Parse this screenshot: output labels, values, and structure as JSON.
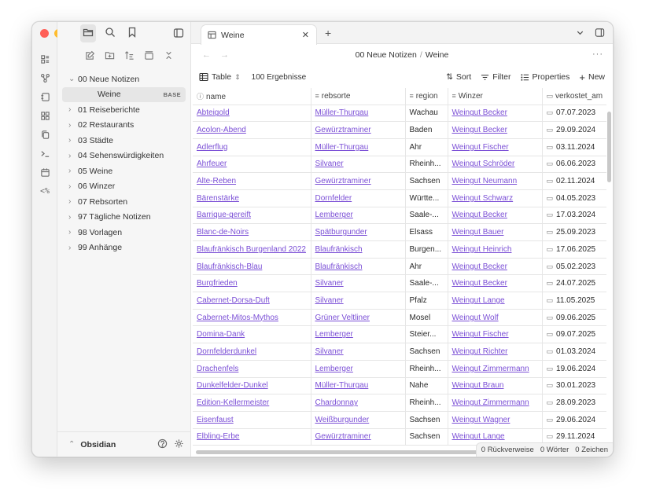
{
  "colors": {
    "close": "#ff5f57",
    "minimize": "#febc2e",
    "zoom": "#28c840",
    "link": "#7b4fd6"
  },
  "ribbon": {
    "icons": [
      "files-icon",
      "graph-icon",
      "canvas-icon",
      "dashboard-icon",
      "copy-icon",
      "terminal-icon",
      "calendar-icon",
      "code-percent-icon"
    ],
    "code_label": "<%"
  },
  "sidebar": {
    "tree": [
      {
        "label": "00 Neue Notizen",
        "expanded": true
      },
      {
        "label": "Weine",
        "badge": "BASE",
        "sub": true
      },
      {
        "label": "01 Reiseberichte"
      },
      {
        "label": "02 Restaurants"
      },
      {
        "label": "03 Städte"
      },
      {
        "label": "04 Sehenswürdigkeiten"
      },
      {
        "label": "05 Weine"
      },
      {
        "label": "06 Winzer"
      },
      {
        "label": "07 Rebsorten"
      },
      {
        "label": "97 Tägliche Notizen"
      },
      {
        "label": "98 Vorlagen"
      },
      {
        "label": "99 Anhänge"
      }
    ],
    "vault_name": "Obsidian"
  },
  "tab": {
    "title": "Weine"
  },
  "breadcrumb": {
    "folder": "00 Neue Notizen",
    "sep": "/",
    "file": "Weine"
  },
  "toolbar": {
    "view_label": "Table",
    "count": "100 Ergebnisse",
    "sort": "Sort",
    "filter": "Filter",
    "properties": "Properties",
    "new": "New"
  },
  "table": {
    "columns": [
      "name",
      "rebsorte",
      "region",
      "Winzer",
      "verkostet_am"
    ],
    "rows": [
      [
        "Abteigold",
        "Müller-Thurgau",
        "Wachau",
        "Weingut Becker",
        "07.07.2023"
      ],
      [
        "Acolon-Abend",
        "Gewürztraminer",
        "Baden",
        "Weingut Becker",
        "29.09.2024"
      ],
      [
        "Adlerflug",
        "Müller-Thurgau",
        "Ahr",
        "Weingut Fischer",
        "03.11.2024"
      ],
      [
        "Ahrfeuer",
        "Silvaner",
        "Rheinh...",
        "Weingut Schröder",
        "06.06.2023"
      ],
      [
        "Alte-Reben",
        "Gewürztraminer",
        "Sachsen",
        "Weingut Neumann",
        "02.11.2024"
      ],
      [
        "Bärenstärke",
        "Dornfelder",
        "Württe...",
        "Weingut Schwarz",
        "04.05.2023"
      ],
      [
        "Barrique-gereift",
        "Lemberger",
        "Saale-...",
        "Weingut Becker",
        "17.03.2024"
      ],
      [
        "Blanc-de-Noirs",
        "Spätburgunder",
        "Elsass",
        "Weingut Bauer",
        "25.09.2023"
      ],
      [
        "Blaufränkisch Burgenland 2022",
        "Blaufränkisch",
        "Burgen...",
        "Weingut Heinrich",
        "17.06.2025"
      ],
      [
        "Blaufränkisch-Blau",
        "Blaufränkisch",
        "Ahr",
        "Weingut Becker",
        "05.02.2023"
      ],
      [
        "Burgfrieden",
        "Silvaner",
        "Saale-...",
        "Weingut Becker",
        "24.07.2025"
      ],
      [
        "Cabernet-Dorsa-Duft",
        "Silvaner",
        "Pfalz",
        "Weingut Lange",
        "11.05.2025"
      ],
      [
        "Cabernet-Mitos-Mythos",
        "Grüner Veltliner",
        "Mosel",
        "Weingut Wolf",
        "09.06.2025"
      ],
      [
        "Domina-Dank",
        "Lemberger",
        "Steier...",
        "Weingut Fischer",
        "09.07.2025"
      ],
      [
        "Dornfelderdunkel",
        "Silvaner",
        "Sachsen",
        "Weingut Richter",
        "01.03.2024"
      ],
      [
        "Drachenfels",
        "Lemberger",
        "Rheinh...",
        "Weingut Zimmermann",
        "19.06.2024"
      ],
      [
        "Dunkelfelder-Dunkel",
        "Müller-Thurgau",
        "Nahe",
        "Weingut Braun",
        "30.01.2023"
      ],
      [
        "Edition-Kellermeister",
        "Chardonnay",
        "Rheinh...",
        "Weingut Zimmermann",
        "28.09.2023"
      ],
      [
        "Eisenfaust",
        "Weißburgunder",
        "Sachsen",
        "Weingut Wagner",
        "29.06.2024"
      ],
      [
        "Elbling-Erbe",
        "Gewürztraminer",
        "Sachsen",
        "Weingut Lange",
        "29.11.2024"
      ]
    ]
  },
  "status": {
    "backlinks": "0 Rückverweise",
    "words": "0 Wörter",
    "chars": "0 Zeichen"
  }
}
